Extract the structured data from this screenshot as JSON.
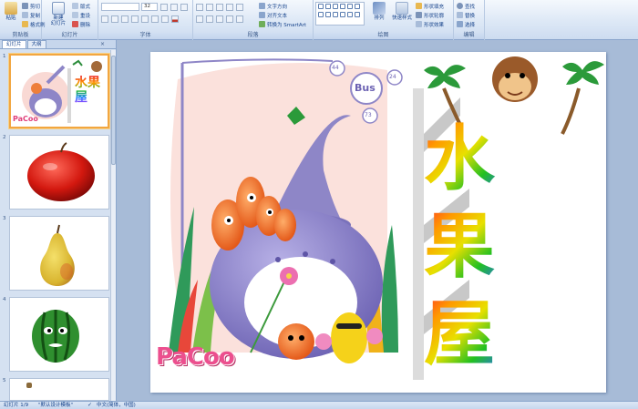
{
  "ribbon": {
    "clipboard": {
      "paste": "粘贴",
      "cut": "剪切",
      "copy": "复制",
      "format_painter": "格式刷",
      "label": "剪贴板"
    },
    "slides": {
      "new_slide": "新建\n幻灯片",
      "layout": "版式",
      "reset": "重设",
      "delete": "删除",
      "label": "幻灯片"
    },
    "font": {
      "font_size": "32",
      "label": "字体"
    },
    "paragraph": {
      "text_direction": "文字方向",
      "align_text": "对齐文本",
      "smartart": "转换为 SmartArt",
      "label": "段落"
    },
    "drawing": {
      "arrange": "排列",
      "quick_styles": "快速样式",
      "shape_fill": "形状填充",
      "shape_outline": "形状轮廓",
      "shape_effects": "形状效果",
      "label": "绘图"
    },
    "editing": {
      "find": "查找",
      "replace": "替换",
      "select": "选择",
      "label": "编辑"
    }
  },
  "panel": {
    "tabs": [
      "幻灯片",
      "大纲"
    ],
    "close": "×"
  },
  "thumbnails": [
    {
      "number": "1",
      "caption": "水果屋"
    },
    {
      "number": "2",
      "caption": ""
    },
    {
      "number": "3",
      "caption": ""
    },
    {
      "number": "4",
      "caption": ""
    },
    {
      "number": "5",
      "caption": ""
    }
  ],
  "slide": {
    "title_chars": [
      "水",
      "果",
      "屋"
    ],
    "bus_badge": "Bus",
    "numbers": [
      "44",
      "24",
      "73"
    ],
    "brand": "PaCoo"
  },
  "status": {
    "slide_counter": "幻灯片 1/9",
    "theme": "\"默认设计模板\"",
    "language": "中文(简体，中国)"
  },
  "colors": {
    "accent": "#f2a640",
    "ribbon": "#dde8f6",
    "workspace": "#a7bbd7"
  }
}
